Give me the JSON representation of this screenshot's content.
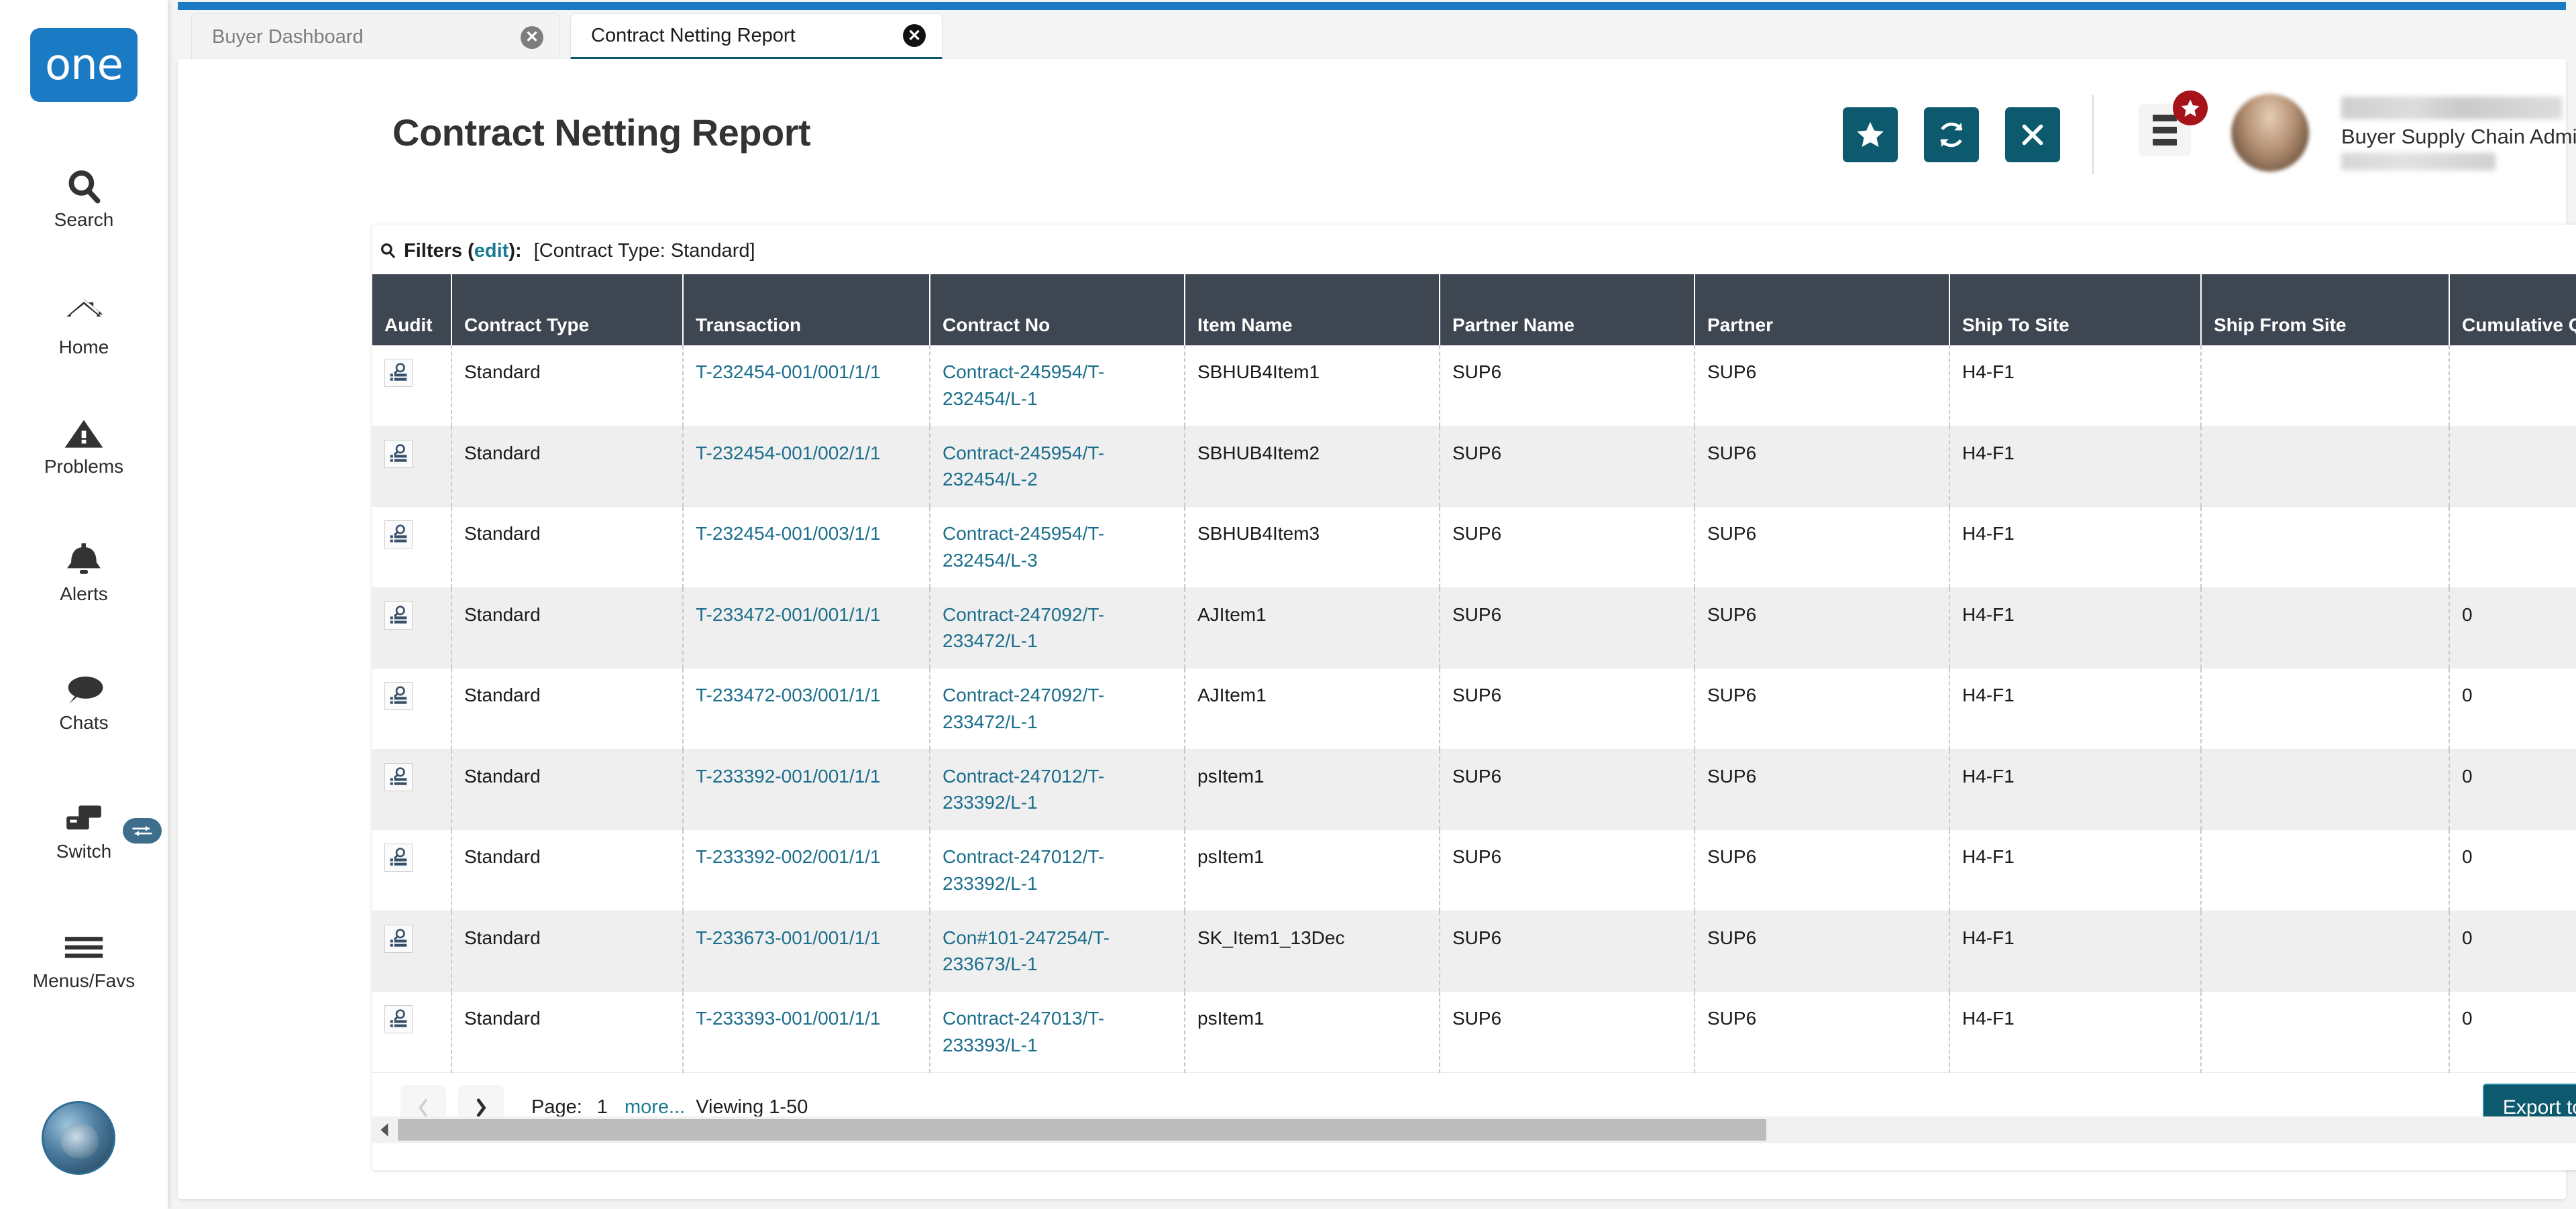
{
  "brand": {
    "logo_text": "one"
  },
  "rail": {
    "items": [
      {
        "icon": "search-icon",
        "label": "Search"
      },
      {
        "icon": "home-icon",
        "label": "Home"
      },
      {
        "icon": "problems-icon",
        "label": "Problems"
      },
      {
        "icon": "alerts-bell-icon",
        "label": "Alerts"
      },
      {
        "icon": "chats-icon",
        "label": "Chats"
      },
      {
        "icon": "switch-icon",
        "label": "Switch"
      },
      {
        "icon": "menus-favs-icon",
        "label": "Menus/Favs"
      }
    ]
  },
  "tabs": [
    {
      "label": "Buyer Dashboard",
      "active": false,
      "close_icon": "close-icon"
    },
    {
      "label": "Contract Netting Report",
      "active": true,
      "close_icon": "close-icon"
    }
  ],
  "header": {
    "title": "Contract Netting Report",
    "actions": [
      {
        "name": "favorite-button",
        "icon": "star-icon"
      },
      {
        "name": "refresh-button",
        "icon": "refresh-icon"
      },
      {
        "name": "close-button",
        "icon": "x-icon"
      }
    ],
    "menus_button": {
      "icon": "hamburger-icon",
      "badge_icon": "star-icon"
    },
    "user": {
      "role": "Buyer Supply Chain Admin",
      "caret_icon": "chevron-down-icon"
    }
  },
  "filters": {
    "icon": "search-icon",
    "label": "Filters (",
    "edit_label": "edit",
    "label_close": "):",
    "value": "[Contract Type: Standard]"
  },
  "grid": {
    "columns": [
      "Audit",
      "Contract Type",
      "Transaction",
      "Contract No",
      "Item Name",
      "Partner Name",
      "Partner",
      "Ship To Site",
      "Ship From Site",
      "Cumulative Qty"
    ],
    "rows": [
      {
        "audit": "audit-icon",
        "contract_type": "Standard",
        "transaction": "T-232454-001/001/1/1",
        "contract_no": "Contract-245954/T-232454/L-1",
        "item_name": "SBHUB4Item1",
        "partner_name": "SUP6",
        "partner": "SUP6",
        "ship_to_site": "H4-F1",
        "ship_from_site": "",
        "cumulative_qty": ""
      },
      {
        "audit": "audit-icon",
        "contract_type": "Standard",
        "transaction": "T-232454-001/002/1/1",
        "contract_no": "Contract-245954/T-232454/L-2",
        "item_name": "SBHUB4Item2",
        "partner_name": "SUP6",
        "partner": "SUP6",
        "ship_to_site": "H4-F1",
        "ship_from_site": "",
        "cumulative_qty": ""
      },
      {
        "audit": "audit-icon",
        "contract_type": "Standard",
        "transaction": "T-232454-001/003/1/1",
        "contract_no": "Contract-245954/T-232454/L-3",
        "item_name": "SBHUB4Item3",
        "partner_name": "SUP6",
        "partner": "SUP6",
        "ship_to_site": "H4-F1",
        "ship_from_site": "",
        "cumulative_qty": ""
      },
      {
        "audit": "audit-icon",
        "contract_type": "Standard",
        "transaction": "T-233472-001/001/1/1",
        "contract_no": "Contract-247092/T-233472/L-1",
        "item_name": "AJItem1",
        "partner_name": "SUP6",
        "partner": "SUP6",
        "ship_to_site": "H4-F1",
        "ship_from_site": "",
        "cumulative_qty": "0"
      },
      {
        "audit": "audit-icon",
        "contract_type": "Standard",
        "transaction": "T-233472-003/001/1/1",
        "contract_no": "Contract-247092/T-233472/L-1",
        "item_name": "AJItem1",
        "partner_name": "SUP6",
        "partner": "SUP6",
        "ship_to_site": "H4-F1",
        "ship_from_site": "",
        "cumulative_qty": "0"
      },
      {
        "audit": "audit-icon",
        "contract_type": "Standard",
        "transaction": "T-233392-001/001/1/1",
        "contract_no": "Contract-247012/T-233392/L-1",
        "item_name": "psItem1",
        "partner_name": "SUP6",
        "partner": "SUP6",
        "ship_to_site": "H4-F1",
        "ship_from_site": "",
        "cumulative_qty": "0"
      },
      {
        "audit": "audit-icon",
        "contract_type": "Standard",
        "transaction": "T-233392-002/001/1/1",
        "contract_no": "Contract-247012/T-233392/L-1",
        "item_name": "psItem1",
        "partner_name": "SUP6",
        "partner": "SUP6",
        "ship_to_site": "H4-F1",
        "ship_from_site": "",
        "cumulative_qty": "0"
      },
      {
        "audit": "audit-icon",
        "contract_type": "Standard",
        "transaction": "T-233673-001/001/1/1",
        "contract_no": "Con#101-247254/T-233673/L-1",
        "item_name": "SK_Item1_13Dec",
        "partner_name": "SUP6",
        "partner": "SUP6",
        "ship_to_site": "H4-F1",
        "ship_from_site": "",
        "cumulative_qty": "0"
      },
      {
        "audit": "audit-icon",
        "contract_type": "Standard",
        "transaction": "T-233393-001/001/1/1",
        "contract_no": "Contract-247013/T-233393/L-1",
        "item_name": "psItem1",
        "partner_name": "SUP6",
        "partner": "SUP6",
        "ship_to_site": "H4-F1",
        "ship_from_site": "",
        "cumulative_qty": "0"
      }
    ]
  },
  "footer": {
    "prev_icon": "chevron-left-icon",
    "next_icon": "chevron-right-icon",
    "page_label": "Page:",
    "page_number": "1",
    "more_label": "more...",
    "viewing_label": "Viewing 1-50",
    "export_label": "Export to CSV"
  },
  "colors": {
    "brand_blue": "#1a7ac4",
    "teal_accent": "#0d5a6e",
    "grid_header": "#3e4652",
    "link": "#1b6e8c",
    "badge_red": "#a6141a"
  }
}
